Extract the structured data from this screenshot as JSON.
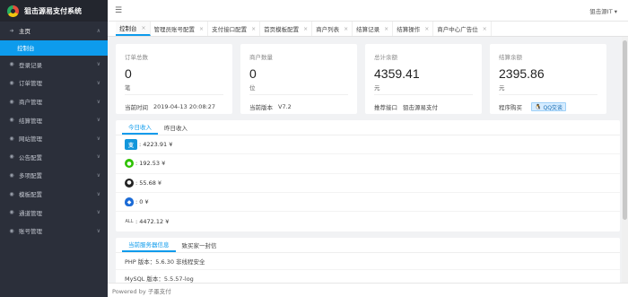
{
  "app": {
    "title": "狙击源易支付系统"
  },
  "header": {
    "user": "狙击源IT ▾"
  },
  "sidebar": {
    "items": [
      {
        "icon": "home-icon",
        "glyph": "➜",
        "label": "主页",
        "expanded": true
      },
      {
        "icon": "user-icon",
        "glyph": "◉",
        "label": "登录记录"
      },
      {
        "icon": "order-icon",
        "glyph": "◉",
        "label": "订单管理"
      },
      {
        "icon": "merchant-icon",
        "glyph": "◉",
        "label": "商户管理"
      },
      {
        "icon": "settle-icon",
        "glyph": "◉",
        "label": "结算管理"
      },
      {
        "icon": "website-icon",
        "glyph": "◉",
        "label": "网站管理"
      },
      {
        "icon": "notice-icon",
        "glyph": "◉",
        "label": "公告配置"
      },
      {
        "icon": "multi-config-icon",
        "glyph": "◉",
        "label": "多项配置"
      },
      {
        "icon": "template-icon",
        "glyph": "◉",
        "label": "模板配置"
      },
      {
        "icon": "channel-icon",
        "glyph": "◉",
        "label": "通道管理"
      },
      {
        "icon": "account-icon",
        "glyph": "◉",
        "label": "账号管理"
      }
    ],
    "active_sub": "控制台"
  },
  "tabs": [
    {
      "label": "控制台",
      "active": true
    },
    {
      "label": "管理员账号配置"
    },
    {
      "label": "支付接口配置"
    },
    {
      "label": "首页模板配置"
    },
    {
      "label": "商户列表"
    },
    {
      "label": "结算记录"
    },
    {
      "label": "结算操作"
    },
    {
      "label": "商户中心广告位"
    }
  ],
  "cards": [
    {
      "title": "订单总数",
      "value": "0",
      "unit": "笔",
      "foot_key": "当前时间",
      "foot_val": "2019-04-13 20:08:27"
    },
    {
      "title": "商户数量",
      "value": "0",
      "unit": "位",
      "foot_key": "当前版本",
      "foot_val": "V7.2"
    },
    {
      "title": "总计余额",
      "value": "4359.41",
      "unit": "元",
      "foot_key": "推荐接口",
      "foot_val": "狙击源易支付"
    },
    {
      "title": "结算余额",
      "value": "2395.86",
      "unit": "元",
      "foot_key": "程序购买",
      "foot_val": "QQ交谈"
    }
  ],
  "income": {
    "tabs": [
      "今日收入",
      "昨日收入"
    ],
    "rows": [
      {
        "icon": "alipay-icon",
        "cls": "alipay",
        "glyph": "支",
        "value": ": 4223.91 ¥"
      },
      {
        "icon": "wechat-icon",
        "cls": "wx",
        "glyph": "●",
        "value": ": 192.53 ¥"
      },
      {
        "icon": "qq-icon",
        "cls": "qq",
        "glyph": "●",
        "value": ": 55.68 ¥"
      },
      {
        "icon": "tenpay-icon",
        "cls": "tenpay",
        "glyph": "◆",
        "value": ": 0 ¥"
      },
      {
        "icon": "all-icon",
        "cls": "all",
        "glyph": "ALL",
        "value": ": 4472.12 ¥"
      }
    ]
  },
  "server": {
    "tabs": [
      "当前服务器信息",
      "致买家一封信"
    ],
    "rows": [
      "PHP 版本：5.6.30 非线程安全",
      "MySQL 版本：5.5.57-log"
    ]
  },
  "footer": {
    "text": "Powered by 子墨支付"
  }
}
